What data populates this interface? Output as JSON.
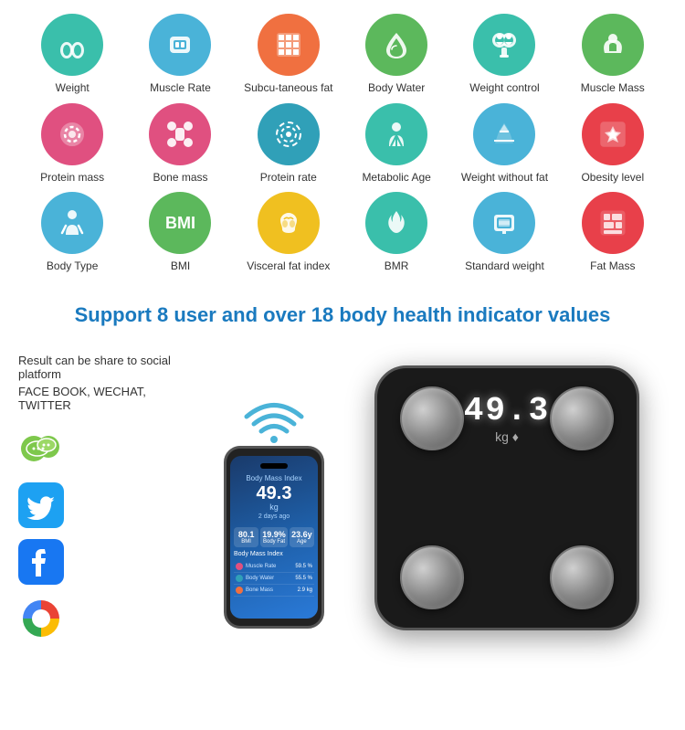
{
  "icons": {
    "row1": [
      {
        "label": "Weight",
        "color": "bg-teal",
        "emoji": "👣",
        "name": "weight"
      },
      {
        "label": "Muscle Rate",
        "color": "bg-blue",
        "emoji": "💪",
        "name": "muscle-rate"
      },
      {
        "label": "Subcu-taneous fat",
        "color": "bg-orange",
        "emoji": "⬛",
        "name": "subcutaneous-fat"
      },
      {
        "label": "Body Water",
        "color": "bg-green",
        "emoji": "💧",
        "name": "body-water"
      },
      {
        "label": "Weight control",
        "color": "bg-teal",
        "emoji": "⚖️",
        "name": "weight-control"
      },
      {
        "label": "Muscle Mass",
        "color": "bg-green",
        "emoji": "💪",
        "name": "muscle-mass"
      }
    ],
    "row2": [
      {
        "label": "Protein mass",
        "color": "bg-pink",
        "emoji": "🔴",
        "name": "protein-mass"
      },
      {
        "label": "Bone mass",
        "color": "bg-pink",
        "emoji": "🦴",
        "name": "bone-mass"
      },
      {
        "label": "Protein rate",
        "color": "bg-cyan",
        "emoji": "⬤",
        "name": "protein-rate"
      },
      {
        "label": "Metabolic Age",
        "color": "bg-teal",
        "emoji": "🚶",
        "name": "metabolic-age"
      },
      {
        "label": "Weight without fat",
        "color": "bg-blue",
        "emoji": "⚡",
        "name": "weight-without-fat"
      },
      {
        "label": "Obesity level",
        "color": "bg-red-light",
        "emoji": "⭐",
        "name": "obesity-level"
      }
    ],
    "row3": [
      {
        "label": "Body Type",
        "color": "bg-blue",
        "emoji": "🧍",
        "name": "body-type"
      },
      {
        "label": "BMI",
        "color": "bg-green",
        "emoji": "BMI",
        "name": "bmi"
      },
      {
        "label": "Visceral fat index",
        "color": "bg-yellow",
        "emoji": "🫁",
        "name": "visceral-fat"
      },
      {
        "label": "BMR",
        "color": "bg-teal",
        "emoji": "🔥",
        "name": "bmr"
      },
      {
        "label": "Standard weight",
        "color": "bg-blue",
        "emoji": "📋",
        "name": "standard-weight"
      },
      {
        "label": "Fat Mass",
        "color": "bg-red-light",
        "emoji": "🔶",
        "name": "fat-mass"
      }
    ]
  },
  "support": {
    "title": "Support 8 user and over 18 body health indicator values"
  },
  "social": {
    "share_text": "Result can be share to social platform",
    "platforms": "FACE BOOK, WECHAT, TWITTER"
  },
  "scale": {
    "weight": "49.3",
    "unit": "kg ♦"
  },
  "phone": {
    "weight": "49.3",
    "unit": "kg",
    "stats": [
      {
        "label": "BMI",
        "value": "80.1"
      },
      {
        "label": "Body Fat",
        "value": "19.9%"
      },
      {
        "label": "Age",
        "value": "23.6y"
      },
      {
        "label": "Body Mass Index",
        "value": ""
      }
    ],
    "list_items": [
      {
        "color": "#e05080",
        "label": "Muscle Rate",
        "value": "59.5%"
      },
      {
        "color": "#30a0b8",
        "label": "Body Water",
        "value": "55.5%"
      },
      {
        "color": "#f07040",
        "label": "Bone Mass",
        "value": "2.9 kg"
      }
    ]
  }
}
